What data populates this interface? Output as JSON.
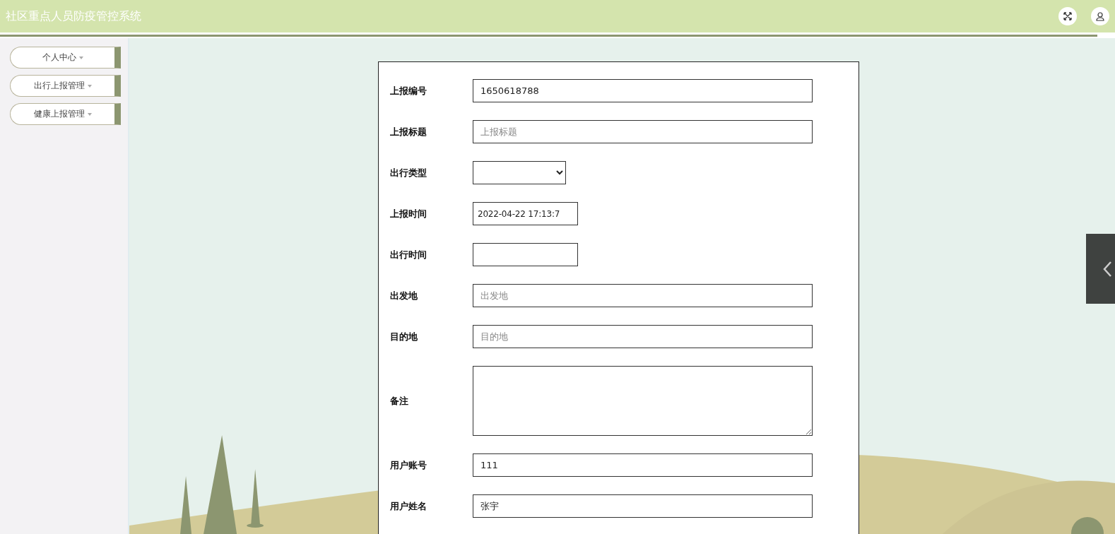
{
  "header": {
    "title": "社区重点人员防疫管控系统"
  },
  "sidebar": {
    "items": [
      {
        "label": "个人中心",
        "expanded": false
      },
      {
        "label": "出行上报管理",
        "expanded": false
      },
      {
        "label": "健康上报管理",
        "expanded": false
      }
    ]
  },
  "form": {
    "fields": [
      {
        "kind": "text",
        "label": "上报编号",
        "value": "1650618788"
      },
      {
        "kind": "text",
        "label": "上报标题",
        "placeholder": "上报标题"
      },
      {
        "kind": "select",
        "label": "出行类型"
      },
      {
        "kind": "short",
        "label": "上报时间",
        "value": "2022-04-22 17:13:7"
      },
      {
        "kind": "short",
        "label": "出行时间"
      },
      {
        "kind": "text",
        "label": "出发地",
        "placeholder": "出发地"
      },
      {
        "kind": "text",
        "label": "目的地",
        "placeholder": "目的地"
      },
      {
        "kind": "textarea",
        "label": "备注"
      },
      {
        "kind": "text",
        "label": "用户账号",
        "value": "111"
      },
      {
        "kind": "text",
        "label": "用户姓名",
        "value": "张宇"
      }
    ]
  }
}
